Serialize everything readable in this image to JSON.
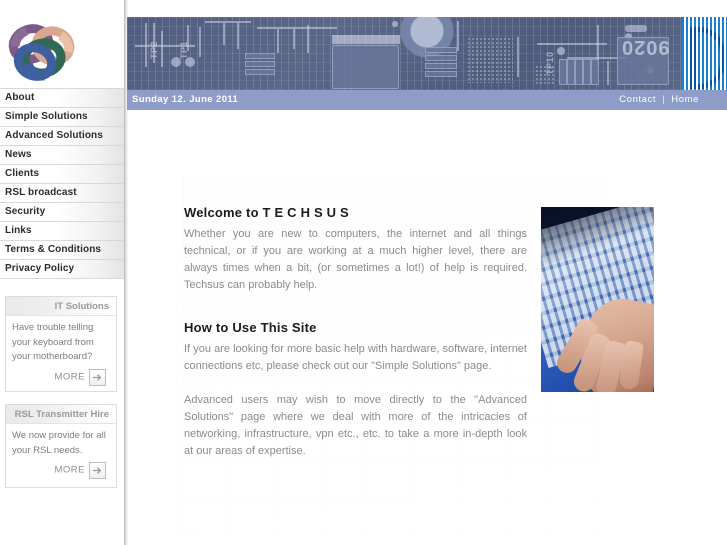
{
  "site": {
    "name": "TECHSUS",
    "logo_icon": "interlocking-rings-logo"
  },
  "sidebar": {
    "nav_items": [
      {
        "label": "About"
      },
      {
        "label": "Simple Solutions"
      },
      {
        "label": "Advanced Solutions"
      },
      {
        "label": "News"
      },
      {
        "label": "Clients"
      },
      {
        "label": "RSL broadcast"
      },
      {
        "label": "Security"
      },
      {
        "label": "Links"
      },
      {
        "label": "Terms & Conditions"
      },
      {
        "label": "Privacy Policy"
      }
    ],
    "widgets": [
      {
        "title": "IT Solutions",
        "body": "Have trouble telling your keyboard from your motherboard?",
        "more_label": "MORE",
        "more_icon": "arrow-right-icon"
      },
      {
        "title": "RSL Transmitter Hire",
        "body": "We now provide for all your RSL needs.",
        "more_label": "MORE",
        "more_icon": "arrow-right-icon"
      }
    ]
  },
  "header": {
    "banner_image": "circuit-board-banner",
    "banner_labels": [
      "TP2",
      "TP1",
      "TP10"
    ],
    "banner_chip_code": "9020",
    "stripe_logo": "blue-striped-d-logo"
  },
  "topbar": {
    "date": "Sunday 12. June 2011",
    "links": [
      {
        "label": "Contact"
      },
      {
        "label": "Home"
      }
    ],
    "separator": "|",
    "background_color": "#8e9cc8"
  },
  "main": {
    "sections": [
      {
        "title": "Welcome to T E C H S U S",
        "paragraphs": [
          "Whether you are new to computers, the internet and all things technical, or if you are working at a much higher level, there are always times when a bit, (or sometimes a lot!) of help is required. Techsus can probably help."
        ]
      },
      {
        "title": "How to Use This Site",
        "paragraphs": [
          "If you are looking for more basic help with hardware, software, internet connections etc, please check out our \"Simple Solutions\" page.",
          "Advanced users may wish to move directly to the \"Advanced Solutions\" page where we deal with more of the intricacies of networking, infrastructure, vpn etc., etc. to take a more in-depth look at our areas of expertise."
        ]
      }
    ],
    "hero_image": "hand-typing-on-blue-keyboard"
  }
}
